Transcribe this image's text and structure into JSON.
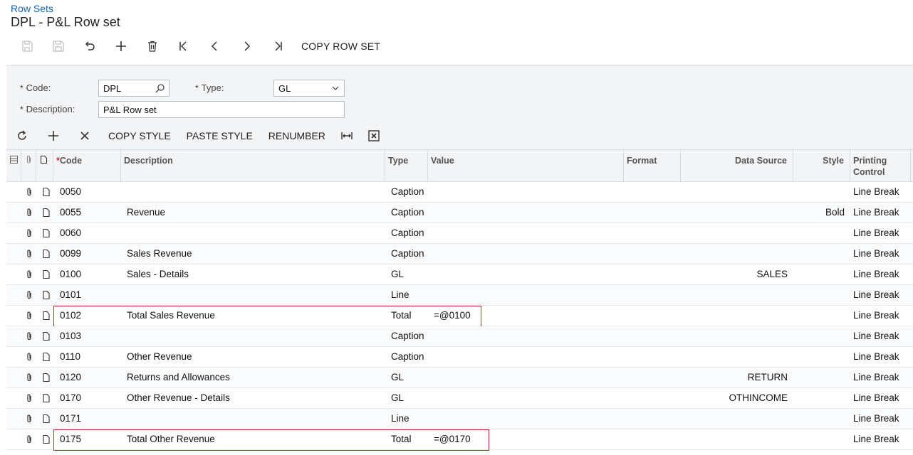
{
  "breadcrumb": "Row Sets",
  "title": "DPL - P&L Row set",
  "toolbar": {
    "copy_row_set": "COPY ROW SET"
  },
  "form": {
    "code_label": "Code:",
    "code_value": "DPL",
    "type_label": "Type:",
    "type_value": "GL",
    "description_label": "Description:",
    "description_value": "P&L Row set"
  },
  "grid_toolbar": {
    "copy_style": "COPY STYLE",
    "paste_style": "PASTE STYLE",
    "renumber": "RENUMBER"
  },
  "columns": {
    "code": "Code",
    "description": "Description",
    "type": "Type",
    "value": "Value",
    "format": "Format",
    "data_source": "Data Source",
    "style": "Style",
    "printing_control_1": "Printing",
    "printing_control_2": "Control"
  },
  "rows": [
    {
      "code": "0050",
      "description": "",
      "type": "Caption",
      "value": "",
      "data_source": "",
      "style": "",
      "printing": "Line Break",
      "highlighted": false
    },
    {
      "code": "0055",
      "description": "Revenue",
      "type": "Caption",
      "value": "",
      "data_source": "",
      "style": "Bold",
      "printing": "Line Break",
      "highlighted": false
    },
    {
      "code": "0060",
      "description": "",
      "type": "Caption",
      "value": "",
      "data_source": "",
      "style": "",
      "printing": "Line Break",
      "highlighted": false
    },
    {
      "code": "0099",
      "description": "Sales Revenue",
      "type": "Caption",
      "value": "",
      "data_source": "",
      "style": "",
      "printing": "Line Break",
      "highlighted": false
    },
    {
      "code": "0100",
      "description": "Sales - Details",
      "type": "GL",
      "value": "",
      "data_source": "SALES",
      "style": "",
      "printing": "Line Break",
      "highlighted": false
    },
    {
      "code": "0101",
      "description": "",
      "type": "Line",
      "value": "",
      "data_source": "",
      "style": "",
      "printing": "Line Break",
      "highlighted": false
    },
    {
      "code": "0102",
      "description": "Total Sales Revenue",
      "type": "Total",
      "value": "=@0100",
      "data_source": "",
      "style": "",
      "printing": "Line Break",
      "highlighted": true
    },
    {
      "code": "0103",
      "description": "",
      "type": "Caption",
      "value": "",
      "data_source": "",
      "style": "",
      "printing": "Line Break",
      "highlighted": false
    },
    {
      "code": "0110",
      "description": "Other Revenue",
      "type": "Caption",
      "value": "",
      "data_source": "",
      "style": "",
      "printing": "Line Break",
      "highlighted": false
    },
    {
      "code": "0120",
      "description": "Returns and Allowances",
      "type": "GL",
      "value": "",
      "data_source": "RETURN",
      "style": "",
      "printing": "Line Break",
      "highlighted": false
    },
    {
      "code": "0170",
      "description": "Other Revenue - Details",
      "type": "GL",
      "value": "",
      "data_source": "OTHINCOME",
      "style": "",
      "printing": "Line Break",
      "highlighted": false
    },
    {
      "code": "0171",
      "description": "",
      "type": "Line",
      "value": "",
      "data_source": "",
      "style": "",
      "printing": "Line Break",
      "highlighted": false
    },
    {
      "code": "0175",
      "description": "Total Other Revenue",
      "type": "Total",
      "value": "=@0170",
      "data_source": "",
      "style": "",
      "printing": "Line Break",
      "highlighted": true
    }
  ]
}
